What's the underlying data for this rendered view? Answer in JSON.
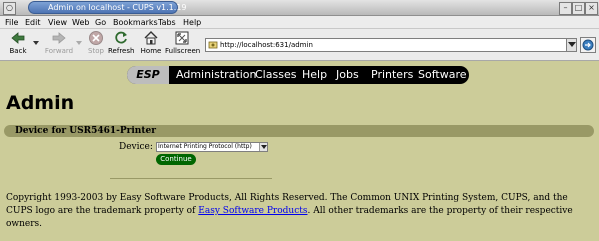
{
  "window": {
    "title": "Admin on localhost - CUPS v1.1.19"
  },
  "menu": [
    "File",
    "Edit",
    "View",
    "Web",
    "Go",
    "Bookmarks",
    "Tabs",
    "Help"
  ],
  "toolbar": {
    "back": "Back",
    "forward": "Forward",
    "stop": "Stop",
    "refresh": "Refresh",
    "home": "Home",
    "fullscreen": "Fullscreen",
    "url": "http://localhost:631/admin"
  },
  "nav": {
    "esp": "ESP",
    "links": [
      "Administration",
      "Classes",
      "Help",
      "Jobs",
      "Printers",
      "Software"
    ]
  },
  "page": {
    "title": "Admin",
    "section_title": "Device for USR5461-Printer",
    "device_label": "Device:",
    "device_value": "Internet Printing Protocol (http)",
    "continue_label": "Continue"
  },
  "footer": {
    "before": "Copyright 1993-2003 by Easy Software Products, All Rights Reserved. The Common UNIX Printing System, CUPS, and the CUPS logo are the trademark property of ",
    "link": "Easy Software Products",
    "after": ". All other trademarks are the property of their respective owners."
  },
  "colors": {
    "page_bg": "#cccc99",
    "section_bar": "#999966",
    "continue_bg": "#006600",
    "nav_bg": "#000000"
  },
  "icons": [
    "back-icon",
    "forward-icon",
    "stop-icon",
    "refresh-icon",
    "home-icon",
    "fullscreen-icon",
    "site-icon",
    "go-icon"
  ]
}
